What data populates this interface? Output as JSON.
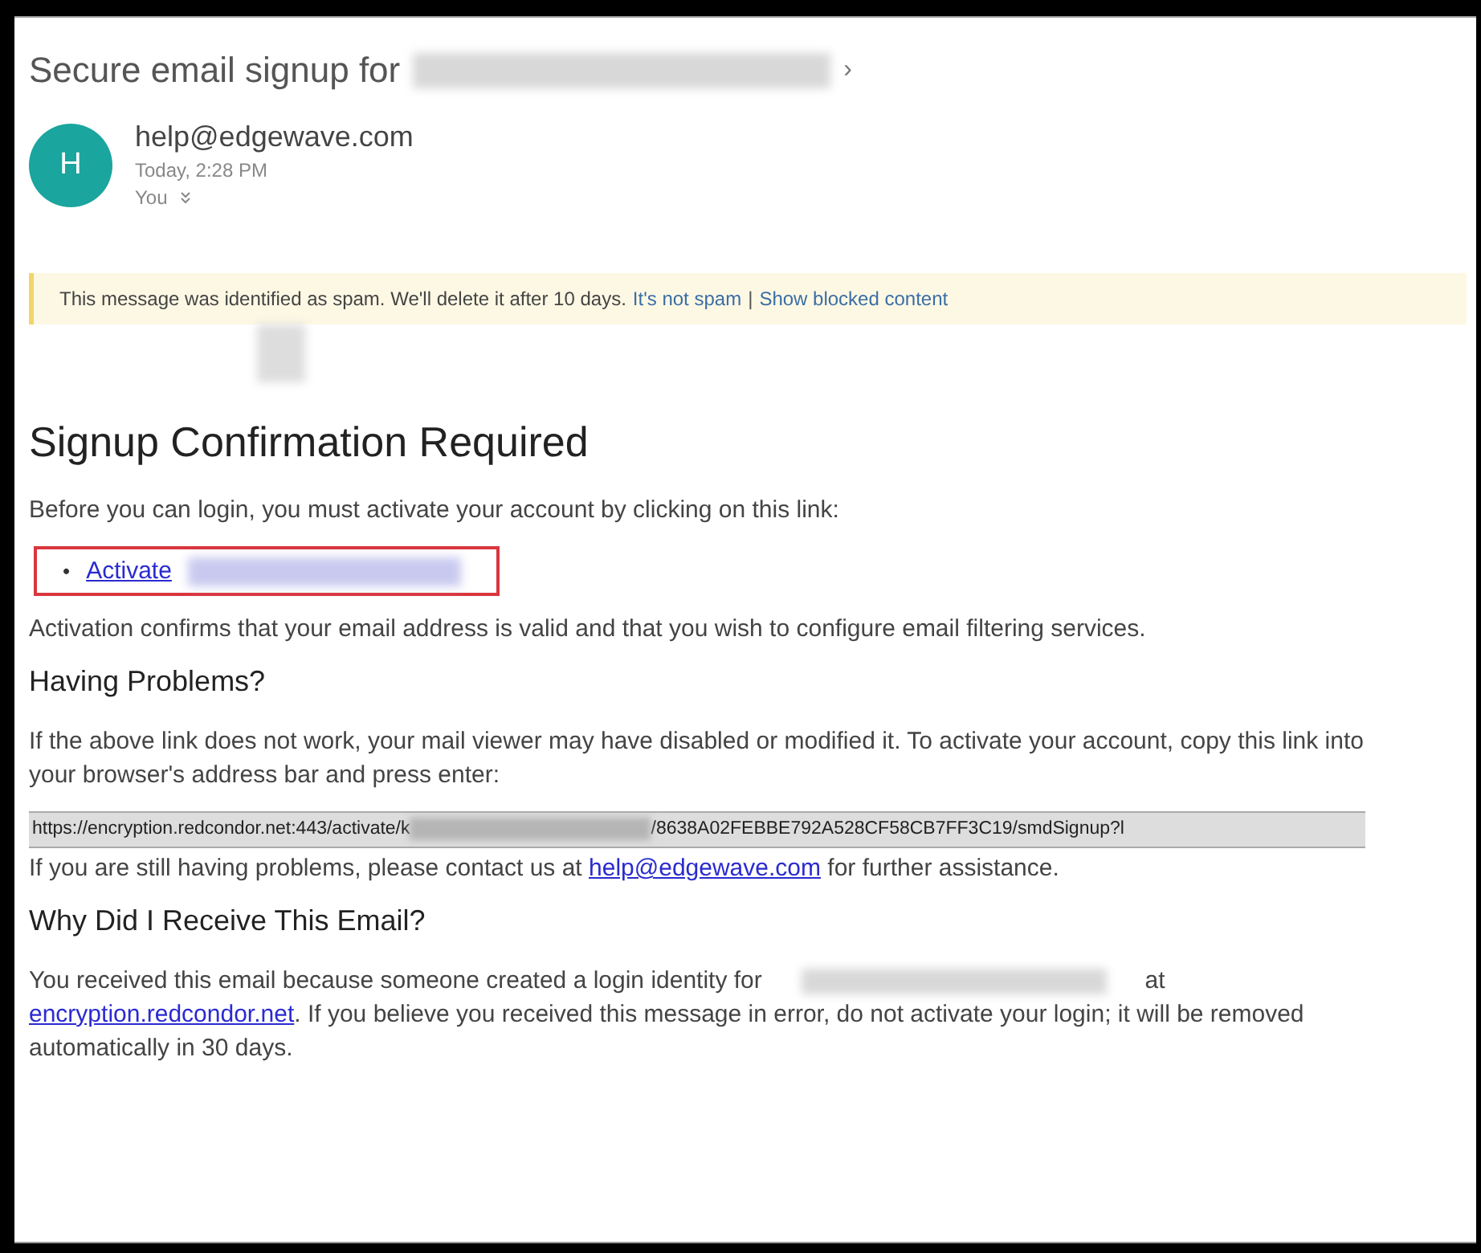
{
  "email": {
    "subject": "Secure email signup for",
    "subject_suffix": "›",
    "sender": {
      "initial": "H",
      "address": "help@edgewave.com",
      "time": "Today, 2:28 PM",
      "recipient": "You"
    },
    "spam_banner": {
      "text": "This message was identified as spam. We'll delete it after 10 days.",
      "not_spam_link": "It's not spam",
      "separator": "|",
      "show_content_link": "Show blocked content"
    },
    "heading": "Signup Confirmation Required",
    "intro": "Before you can login, you must activate your account by clicking on this link:",
    "activate": {
      "bullet": "•",
      "link": "Activate",
      "highlighted": true
    },
    "activation_note": "Activation confirms that your email address is valid and that you wish to configure email filtering services.",
    "problems": {
      "heading": "Having Problems?",
      "text": "If the above link does not work, your mail viewer may have disabled or modified it. To activate your account, copy this link into your browser's address bar and press enter:",
      "url_start": "https://encryption.redcondor.net:443/activate/k",
      "url_end": "/8638A02FEBBE792A528CF58CB7FF3C19/smdSignup?l",
      "contact_before": "If you are still having problems, please contact us at",
      "contact_link": "help@edgewave.com",
      "contact_after": "for further assistance."
    },
    "why": {
      "heading": "Why Did I Receive This Email?",
      "text_before": "You received this email because someone created a login identity for",
      "text_at": "at",
      "link": "encryption.redcondor.net",
      "text_after": ". If you believe you received this message in error, do not activate your login; it will be removed automatically in 30 days."
    }
  }
}
